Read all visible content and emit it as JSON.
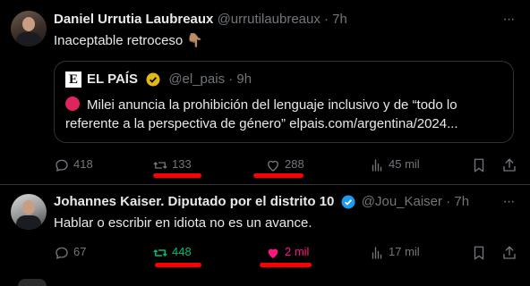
{
  "tweet1": {
    "name": "Daniel Urrutia Laubreaux",
    "handle": "@urrutilaubreaux · 7h",
    "text": "Inaceptable retroceso 👇🏽",
    "quote": {
      "logo": "E",
      "name": "EL PAÍS",
      "handle": "@el_pais · 9h",
      "text": "Milei anuncia la prohibición del lenguaje inclusivo y de “todo lo referente a la perspectiva de género” elpais.com/argentina/2024..."
    },
    "actions": {
      "replies": "418",
      "retweets": "133",
      "likes": "288",
      "views": "45 mil"
    }
  },
  "tweet2": {
    "name": "Johannes Kaiser. Diputado por el distrito 10",
    "handle": "@Jou_Kaiser · 7h",
    "text": "Hablar o escribir en idiota no es un avance.",
    "actions": {
      "replies": "67",
      "retweets": "448",
      "likes": "2 mil",
      "views": "17 mil"
    }
  },
  "colors": {
    "background": "#000000",
    "text": "#e7e9ea",
    "muted": "#71767b",
    "retweet_active": "#00ba7c",
    "like_active": "#f91880",
    "verified": "#1d9bf0",
    "annotation": "#ff0000"
  },
  "icons": [
    "more-icon",
    "reply-icon",
    "retweet-icon",
    "like-icon",
    "views-icon",
    "bookmark-icon",
    "share-icon",
    "verified-icon"
  ]
}
